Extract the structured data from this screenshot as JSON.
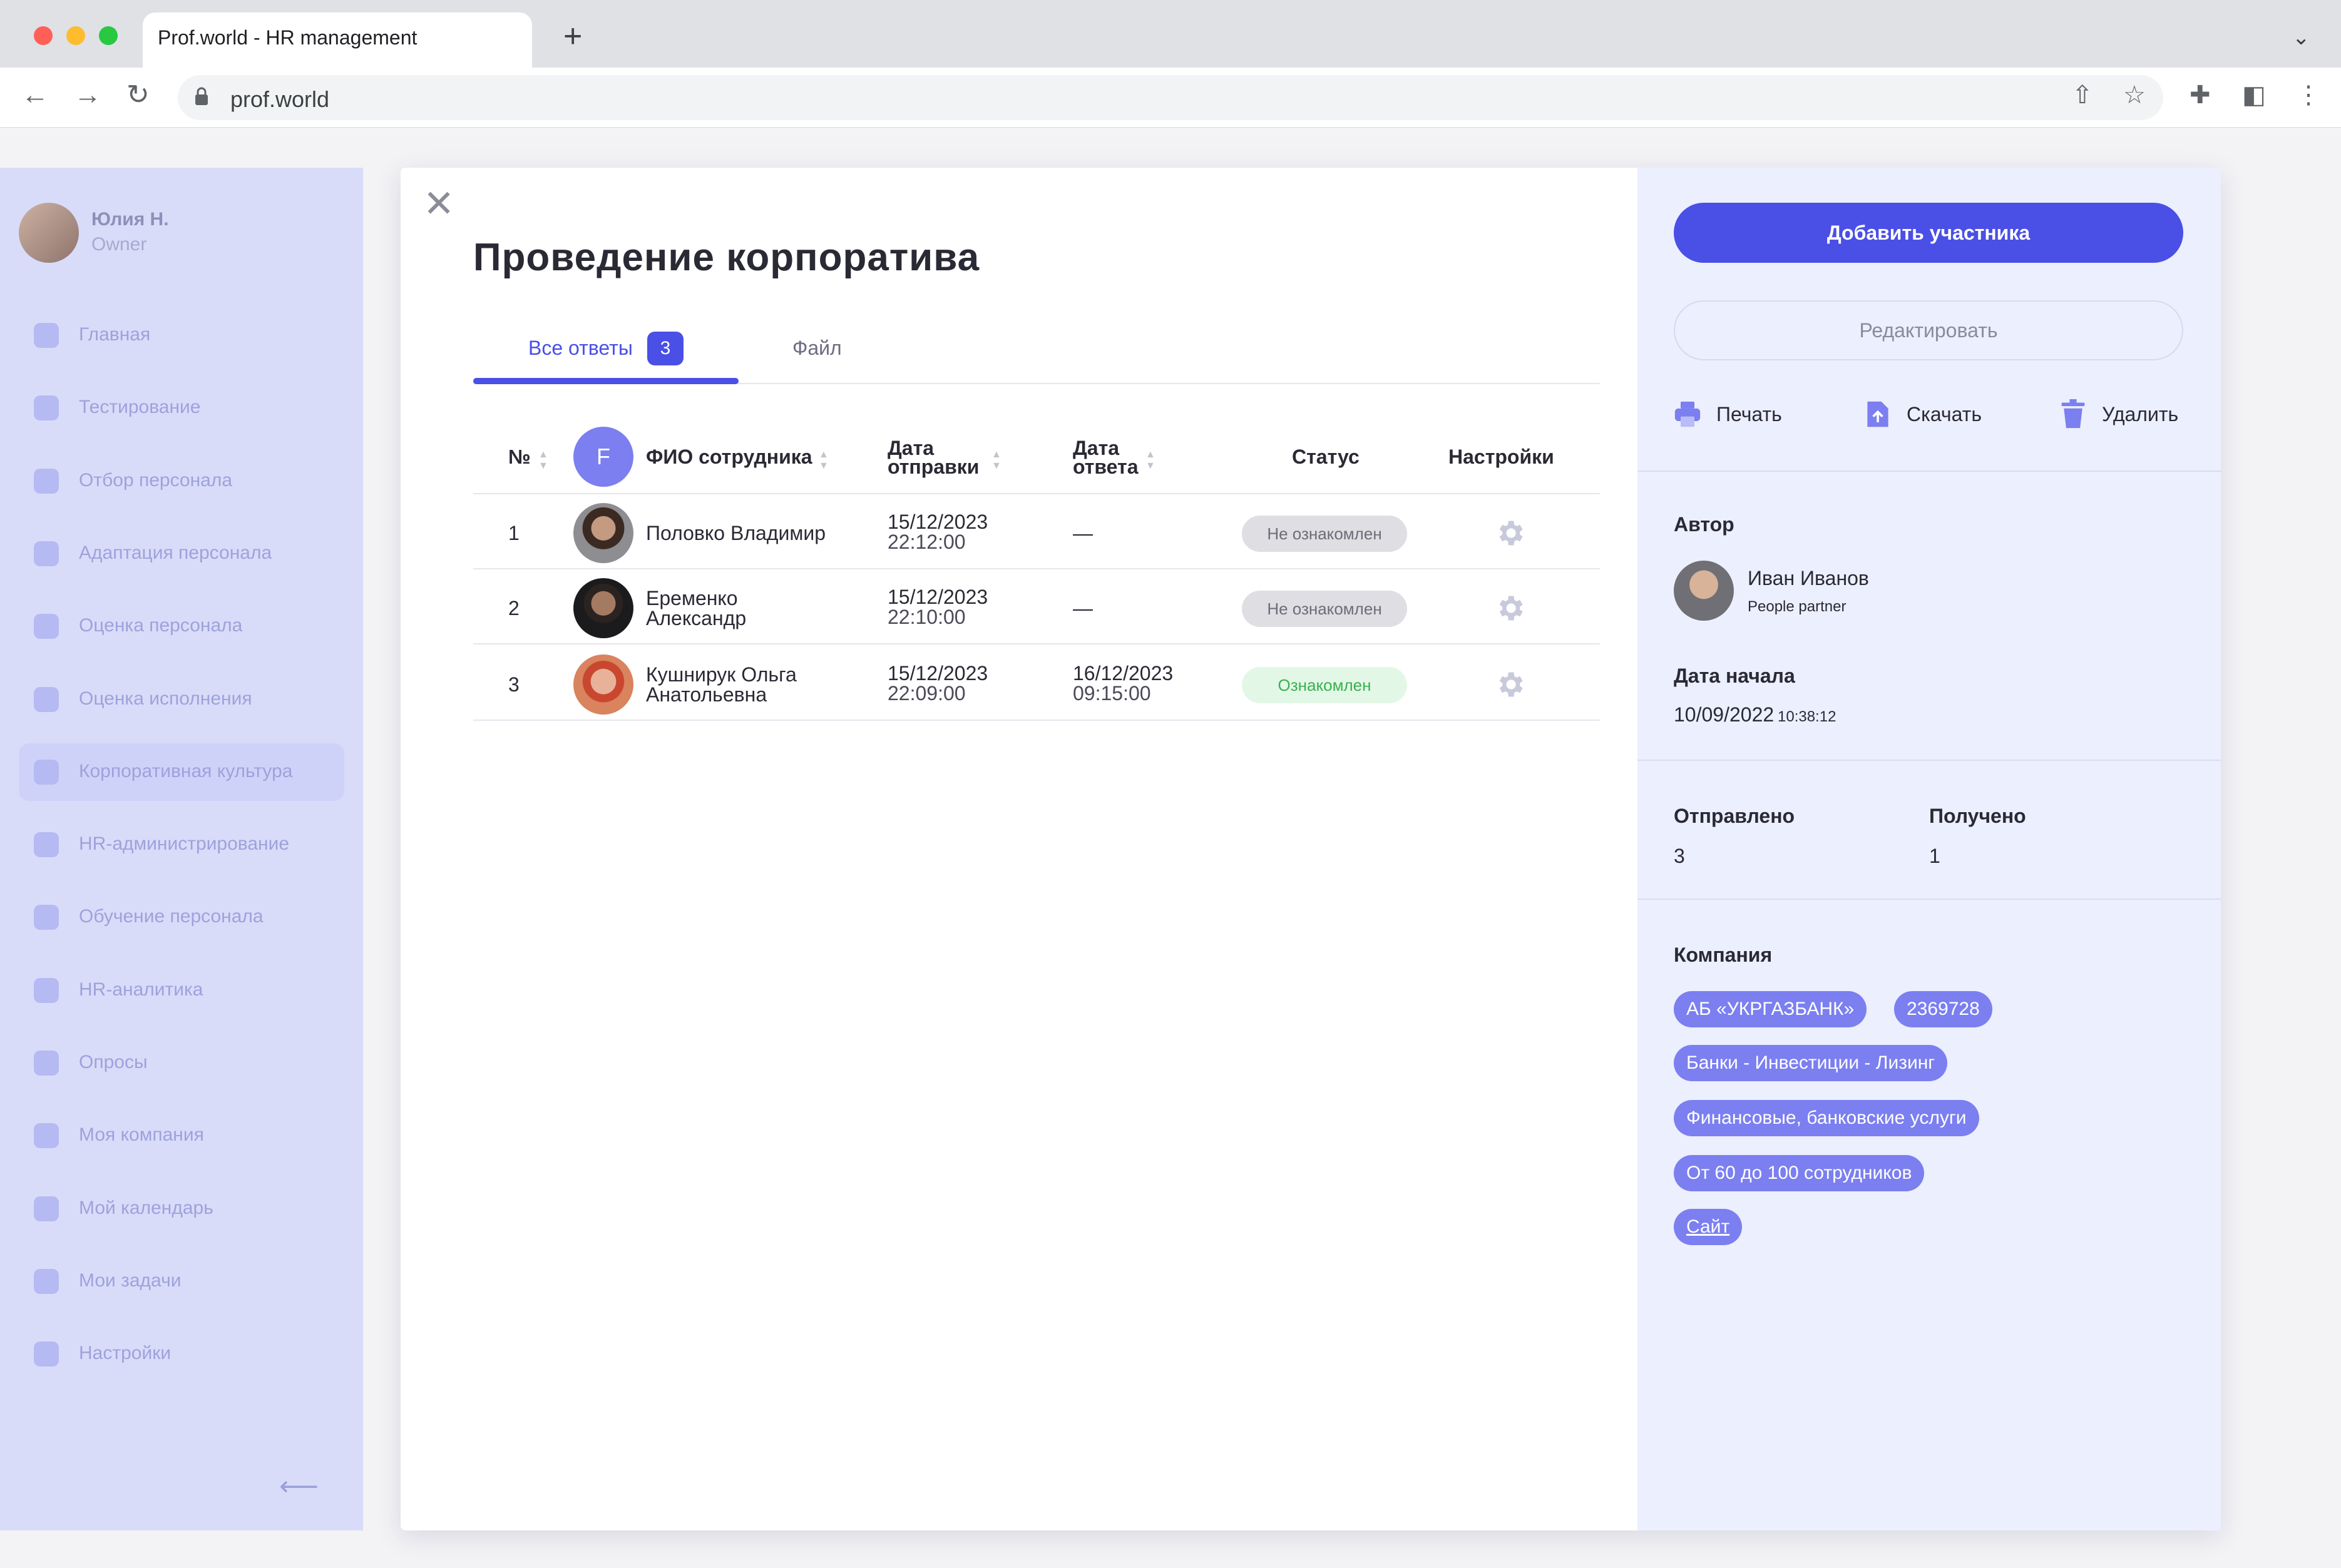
{
  "browser": {
    "tab_title": "Prof.world  - HR management",
    "url": "prof.world"
  },
  "sidebar": {
    "user_name": "Юлия Н.",
    "user_role": "Owner",
    "items": [
      {
        "label": "Главная",
        "icon": "home-icon"
      },
      {
        "label": "Тестирование",
        "icon": "clipboard-icon"
      },
      {
        "label": "Отбор персонала",
        "icon": "people-icon"
      },
      {
        "label": "Адаптация персонала",
        "icon": "heart-icon"
      },
      {
        "label": "Оценка персонала",
        "icon": "people-rating-icon"
      },
      {
        "label": "Оценка исполнения",
        "icon": "person-icon"
      },
      {
        "label": "Корпоративная культура",
        "icon": "gamepad-icon",
        "active": true
      },
      {
        "label": "HR-администрирование",
        "icon": "sliders-icon"
      },
      {
        "label": "Обучение персонала",
        "icon": "graduation-cap-icon"
      },
      {
        "label": "HR-аналитика",
        "icon": "bar-chart-icon"
      },
      {
        "label": "Опросы",
        "icon": "list-icon"
      },
      {
        "label": "Моя компания",
        "icon": "building-icon"
      },
      {
        "label": "Мой календарь",
        "icon": "calendar-icon"
      },
      {
        "label": "Мои задачи",
        "icon": "checkbox-icon"
      },
      {
        "label": "Настройки",
        "icon": "gear-icon"
      }
    ]
  },
  "modal": {
    "title": "Проведение корпоратива",
    "tabs": [
      {
        "label": "Все ответы",
        "badge": "3"
      },
      {
        "label": "Файл"
      }
    ],
    "table": {
      "headers": {
        "num": "№",
        "avatar_initial": "F",
        "name": "ФИО сотрудника",
        "sent_line1": "Дата",
        "sent_line2": "отправки",
        "answer_line1": "Дата",
        "answer_line2": "ответа",
        "status": "Статус",
        "settings": "Настройки"
      },
      "rows": [
        {
          "num": "1",
          "name_line1": "Половко Владимир",
          "name_line2": "",
          "sent_date": "15/12/2023",
          "sent_time": "22:12:00",
          "answer_date": "—",
          "answer_time": "",
          "status": "Не ознакомлен",
          "status_kind": "not-acknowledged"
        },
        {
          "num": "2",
          "name_line1": "Еременко",
          "name_line2": "Александр",
          "sent_date": "15/12/2023",
          "sent_time": "22:10:00",
          "answer_date": "—",
          "answer_time": "",
          "status": "Не ознакомлен",
          "status_kind": "not-acknowledged"
        },
        {
          "num": "3",
          "name_line1": "Кушнирук Ольга",
          "name_line2": "Анатольевна",
          "sent_date": "15/12/2023",
          "sent_time": "22:09:00",
          "answer_date": "16/12/2023",
          "answer_time": "09:15:00",
          "status": "Ознакомлен",
          "status_kind": "acknowledged"
        }
      ]
    }
  },
  "panel": {
    "add_button": "Добавить участника",
    "edit_button": "Редактировать",
    "actions": {
      "print": "Печать",
      "download": "Скачать",
      "delete": "Удалить"
    },
    "author_label": "Автор",
    "author_name": "Иван Иванов",
    "author_role": "People partner",
    "start_label": "Дата начала",
    "start_date": "10/09/2022",
    "start_time": "10:38:12",
    "sent_label": "Отправлено",
    "sent_value": "3",
    "received_label": "Получено",
    "received_value": "1",
    "company_label": "Компания",
    "chips": [
      "АБ «УКРГАЗБАНК»",
      "2369728",
      "Банки - Инвестиции - Лизинг",
      "Финансовые, банковские услуги",
      "От 60 до 100 сотрудников",
      "Сайт"
    ]
  },
  "colors": {
    "accent": "#4a4fe6",
    "chip": "#7b7ff0",
    "panel_bg": "#eceffe",
    "status_ok_text": "#38b24e"
  }
}
